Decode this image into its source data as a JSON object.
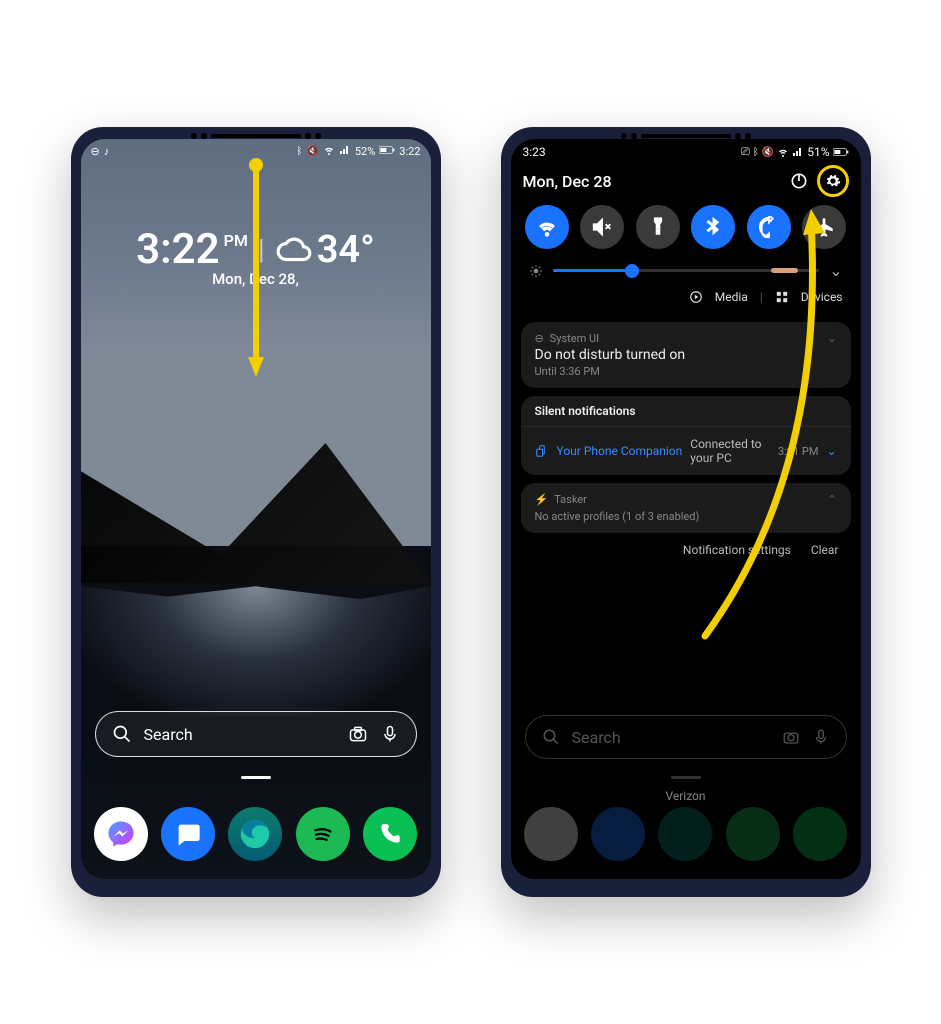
{
  "left": {
    "status": {
      "dnd_icon": "dnd-icon",
      "music_icon": "music-icon",
      "bt_icon": "bluetooth-icon",
      "mute_icon": "mute-icon",
      "wifi_icon": "wifi-icon",
      "signal_icon": "signal-icon",
      "battery_pct": "52%",
      "time": "3:22"
    },
    "clock": {
      "time": "3:22",
      "ampm": "PM",
      "temp": "34°",
      "date": "Mon, Dec 28,"
    },
    "search": {
      "placeholder": "Search"
    },
    "dock": {
      "apps": [
        {
          "name": "messenger-app",
          "color": "#fff",
          "inner": "#c837ff"
        },
        {
          "name": "messages-app",
          "color": "#1a73ff"
        },
        {
          "name": "edge-app",
          "color": "#0b7b6b"
        },
        {
          "name": "spotify-app",
          "color": "#1db954"
        },
        {
          "name": "phone-app",
          "color": "#0abf53"
        }
      ]
    },
    "annotation": "swipe-down-arrow"
  },
  "right": {
    "status": {
      "time": "3:23",
      "battery_pct": "51%"
    },
    "header": {
      "date": "Mon, Dec 28",
      "power_icon": "power-icon",
      "gear_icon": "gear-icon"
    },
    "toggles": [
      {
        "name": "wifi-toggle",
        "on": true,
        "icon": "wifi"
      },
      {
        "name": "sound-toggle",
        "on": false,
        "icon": "mute"
      },
      {
        "name": "flashlight-toggle",
        "on": false,
        "icon": "flashlight"
      },
      {
        "name": "bluetooth-toggle",
        "on": true,
        "icon": "bluetooth"
      },
      {
        "name": "rotate-toggle",
        "on": true,
        "icon": "rotate"
      },
      {
        "name": "airplane-toggle",
        "on": false,
        "icon": "airplane"
      }
    ],
    "brightness_pct": 30,
    "buttons": {
      "media": "Media",
      "devices": "Devices"
    },
    "notifs": {
      "dnd": {
        "app": "System UI",
        "title": "Do not disturb turned on",
        "sub": "Until 3:36 PM"
      },
      "silent_header": "Silent notifications",
      "phone": {
        "app": "Your Phone Companion",
        "msg": "Connected to your PC",
        "time": "3:01 PM"
      },
      "tasker": {
        "app": "Tasker",
        "title": "No active profiles (1 of 3 enabled)"
      },
      "footer": {
        "settings": "Notification settings",
        "clear": "Clear"
      }
    },
    "dim": {
      "search_placeholder": "Search",
      "carrier": "Verizon"
    },
    "annotation": "curved-arrow-to-gear"
  }
}
